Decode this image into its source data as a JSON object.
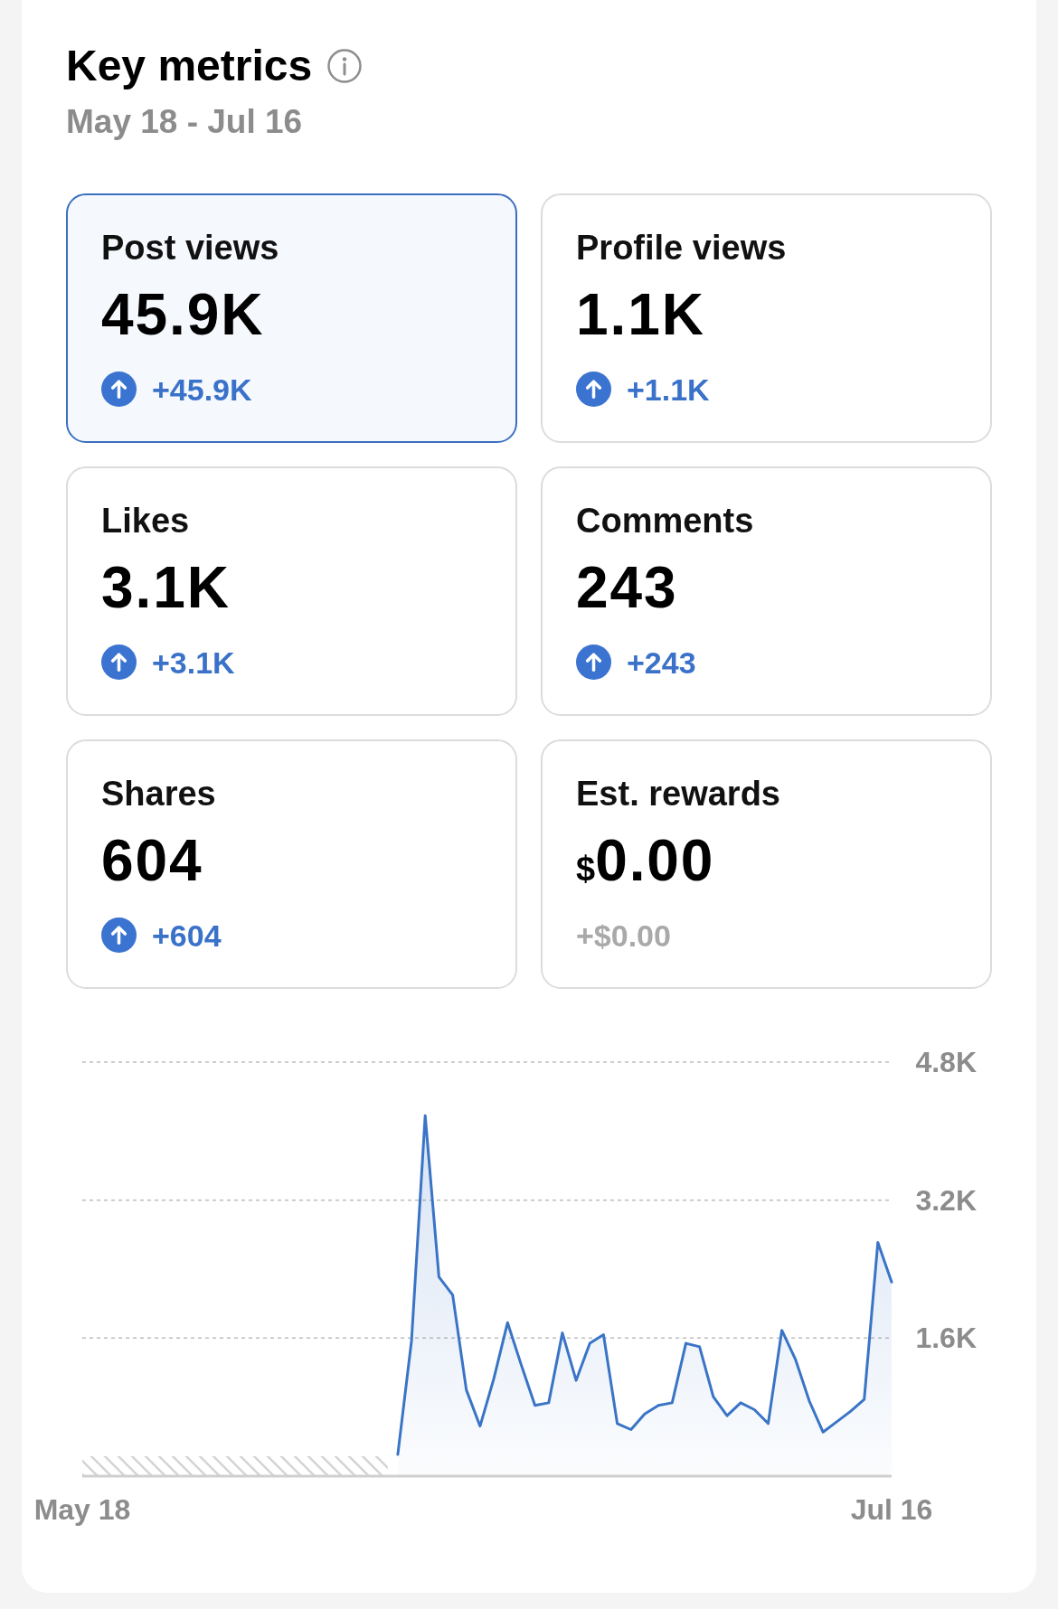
{
  "header": {
    "title": "Key metrics",
    "date_range": "May 18 - Jul 16"
  },
  "metrics": [
    {
      "label": "Post views",
      "value": "45.9K",
      "change": "+45.9K",
      "kind": "up",
      "selected": true
    },
    {
      "label": "Profile views",
      "value": "1.1K",
      "change": "+1.1K",
      "kind": "up",
      "selected": false
    },
    {
      "label": "Likes",
      "value": "3.1K",
      "change": "+3.1K",
      "kind": "up",
      "selected": false
    },
    {
      "label": "Comments",
      "value": "243",
      "change": "+243",
      "kind": "up",
      "selected": false
    },
    {
      "label": "Shares",
      "value": "604",
      "change": "+604",
      "kind": "up",
      "selected": false
    },
    {
      "label": "Est. rewards",
      "prefix": "$",
      "value": "0.00",
      "change": "+$0.00",
      "kind": "flat",
      "selected": false
    }
  ],
  "chart": {
    "chart_data": {
      "type": "area",
      "categories": [
        "May 18",
        null,
        null,
        null,
        null,
        null,
        null,
        null,
        null,
        null,
        null,
        null,
        null,
        null,
        null,
        null,
        null,
        null,
        null,
        null,
        null,
        null,
        null,
        null,
        null,
        null,
        null,
        null,
        null,
        null,
        null,
        null,
        null,
        null,
        null,
        null,
        null,
        null,
        null,
        null,
        null,
        null,
        null,
        null,
        null,
        null,
        null,
        null,
        null,
        null,
        null,
        null,
        null,
        null,
        null,
        null,
        null,
        null,
        null,
        "Jul 16"
      ],
      "series": [
        {
          "color": "#3a74c6",
          "values": [
            null,
            null,
            null,
            null,
            null,
            null,
            null,
            null,
            null,
            null,
            null,
            null,
            null,
            null,
            null,
            null,
            null,
            null,
            null,
            null,
            null,
            null,
            null,
            250,
            1570,
            4180,
            2310,
            2100,
            1000,
            580,
            1130,
            1780,
            1290,
            820,
            850,
            1660,
            1110,
            1540,
            1640,
            610,
            540,
            720,
            820,
            850,
            1540,
            1500,
            920,
            700,
            850,
            770,
            610,
            1690,
            1350,
            870,
            510,
            630,
            750,
            890,
            2710,
            2250
          ]
        }
      ],
      "ylim": [
        0,
        4800
      ],
      "yticks": [
        {
          "value": 1600,
          "label": "1.6K"
        },
        {
          "value": 3200,
          "label": "3.2K"
        },
        {
          "value": 4800,
          "label": "4.8K"
        }
      ]
    }
  }
}
